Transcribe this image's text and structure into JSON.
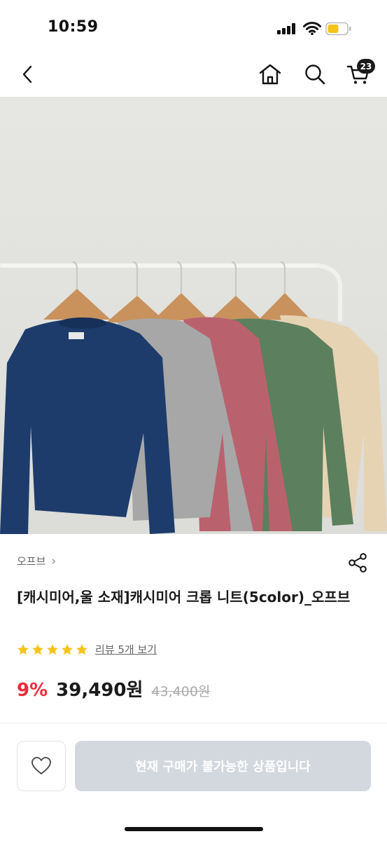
{
  "status_bar": {
    "time": "10:59"
  },
  "nav": {
    "cart_count": "23"
  },
  "product": {
    "brand": "오프브",
    "brand_chevron": "›",
    "title": "[캐시미어,울 소재]캐시미어 크롭 니트(5color)_오프브",
    "rating_stars": 5,
    "review_link": "리뷰 5개 보기",
    "discount": "9%",
    "price": "39,490원",
    "original_price": "43,400원",
    "sweater_colors": [
      "#1d3c6b",
      "#a7a7a7",
      "#b9626e",
      "#5c7f5d",
      "#e6d3b3"
    ]
  },
  "bottom_bar": {
    "buy_label": "현재 구매가 불가능한 상품입니다"
  },
  "colors": {
    "discount": "#ee2b3b",
    "disabled_button": "#d3d7de",
    "star": "#f5c41b"
  }
}
